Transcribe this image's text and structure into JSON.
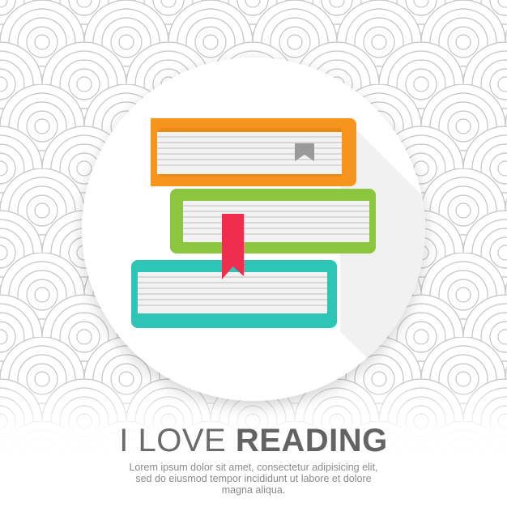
{
  "headline": {
    "light": "I LOVE",
    "bold": "READING"
  },
  "body_text": "Lorem ipsum dolor sit amet, consectetur adipisicing elit, sed do eiusmod tempor incididunt ut labore et dolore magna aliqua.",
  "colors": {
    "background": "#ffffff",
    "pattern_stroke": "#c4c4c4",
    "badge": "#ffffff",
    "book_top": "#f7941e",
    "book_middle": "#8cc63f",
    "book_bottom": "#2ec4b6",
    "bookmark": "#ee2d4f",
    "pages": "#f2f2f2",
    "page_lines": "#cfcfcf"
  }
}
